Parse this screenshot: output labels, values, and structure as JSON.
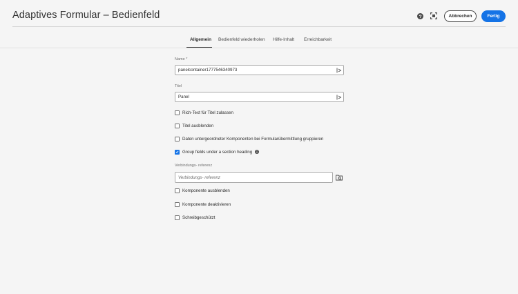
{
  "header": {
    "title": "Adaptives Formular – Bedienfeld",
    "help_icon": "help-icon",
    "fullscreen_icon": "fullscreen-icon",
    "cancel_label": "Abbrechen",
    "done_label": "Fertig"
  },
  "tabs": [
    {
      "label": "Allgemein",
      "active": true
    },
    {
      "label": "Bedienfeld wiederholen",
      "active": false
    },
    {
      "label": "Hilfe-Inhalt",
      "active": false
    },
    {
      "label": "Erreichbarkeit",
      "active": false
    }
  ],
  "form": {
    "name_label": "Name *",
    "name_value": "panelcontainer1777546340973",
    "title_label": "Titel",
    "title_value": "Panel",
    "checkboxes_top": [
      {
        "label": "Rich-Text für Titel zulassen",
        "checked": false
      },
      {
        "label": "Titel ausblenden",
        "checked": false
      },
      {
        "label": "Daten untergeordneter Komponenten bei Formularübermittlung gruppieren",
        "checked": false
      },
      {
        "label": "Group fields under a section heading",
        "checked": true
      }
    ],
    "binding_label": "Verbindungs- referenz",
    "binding_placeholder": "Verbindungs- referenz",
    "checkboxes_bottom": [
      {
        "label": "Komponente ausblenden",
        "checked": false
      },
      {
        "label": "Komponente deaktivieren",
        "checked": false
      },
      {
        "label": "Schreibgeschützt",
        "checked": false
      }
    ]
  },
  "colors": {
    "accent": "#1473e6",
    "background": "#f5f5f5"
  }
}
